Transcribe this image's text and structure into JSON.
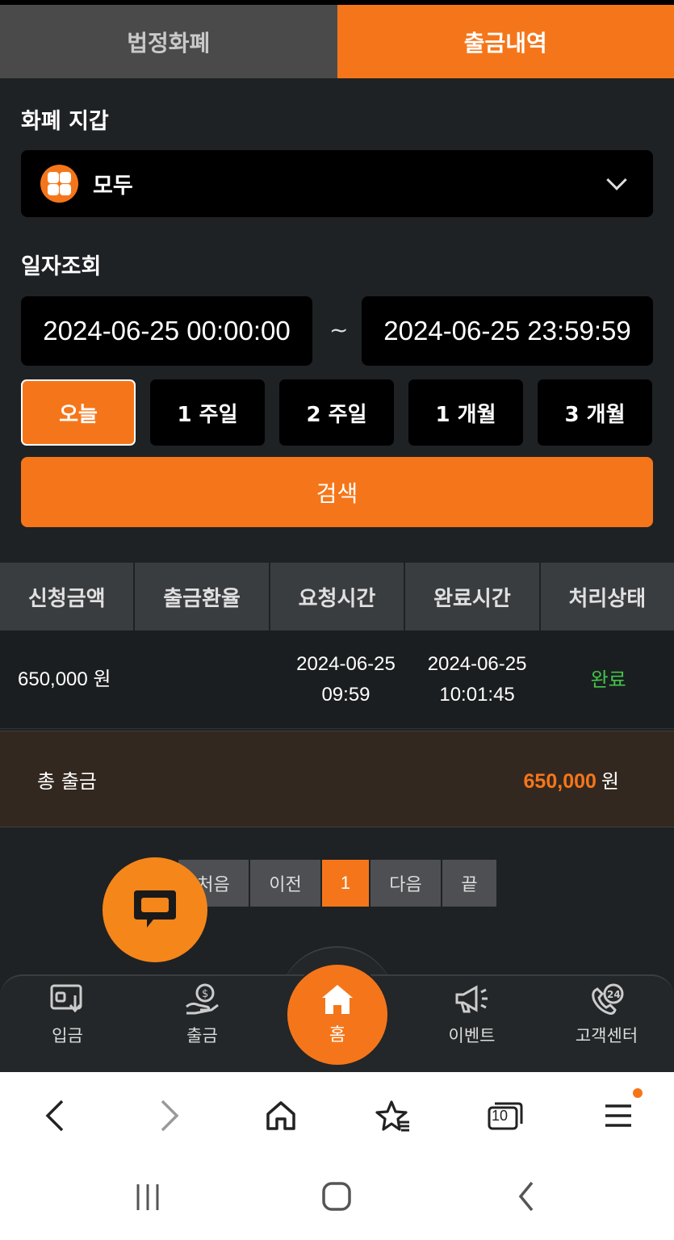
{
  "tabs": [
    {
      "label": "법정화폐",
      "active": false
    },
    {
      "label": "출금내역",
      "active": true
    }
  ],
  "wallet": {
    "section_label": "화폐 지갑",
    "icon": "grid-dots-icon",
    "selected_value": "모두"
  },
  "date_filter": {
    "section_label": "일자조회",
    "start": "2024-06-25 00:00:00",
    "separator": "~",
    "end": "2024-06-25 23:59:59"
  },
  "periods": [
    {
      "label": "오늘",
      "active": true
    },
    {
      "label": "1 주일",
      "active": false
    },
    {
      "label": "2 주일",
      "active": false
    },
    {
      "label": "1 개월",
      "active": false
    },
    {
      "label": "3 개월",
      "active": false
    }
  ],
  "search_label": "검색",
  "table": {
    "headers": [
      "신청금액",
      "출금환율",
      "요청시간",
      "완료시간",
      "처리상태"
    ],
    "rows": [
      {
        "amount": "650,000 원",
        "rate": "",
        "request_date": "2024-06-25",
        "request_time": "09:59",
        "complete_date": "2024-06-25",
        "complete_time": "10:01:45",
        "status": "완료"
      }
    ]
  },
  "total": {
    "label": "총 출금",
    "amount": "650,000",
    "unit": "원"
  },
  "pagination": {
    "first": "처음",
    "prev": "이전",
    "current": "1",
    "next": "다음",
    "last": "끝"
  },
  "bottom_nav": [
    {
      "label": "입금",
      "icon": "deposit-icon"
    },
    {
      "label": "출금",
      "icon": "withdraw-icon"
    },
    {
      "label": "홈",
      "icon": "home-icon"
    },
    {
      "label": "이벤트",
      "icon": "megaphone-icon"
    },
    {
      "label": "고객센터",
      "icon": "support-24-icon"
    }
  ],
  "browser": {
    "tab_count": "10"
  },
  "colors": {
    "accent": "#f5761a",
    "status_complete": "#43c44a",
    "background": "#1e2224"
  }
}
